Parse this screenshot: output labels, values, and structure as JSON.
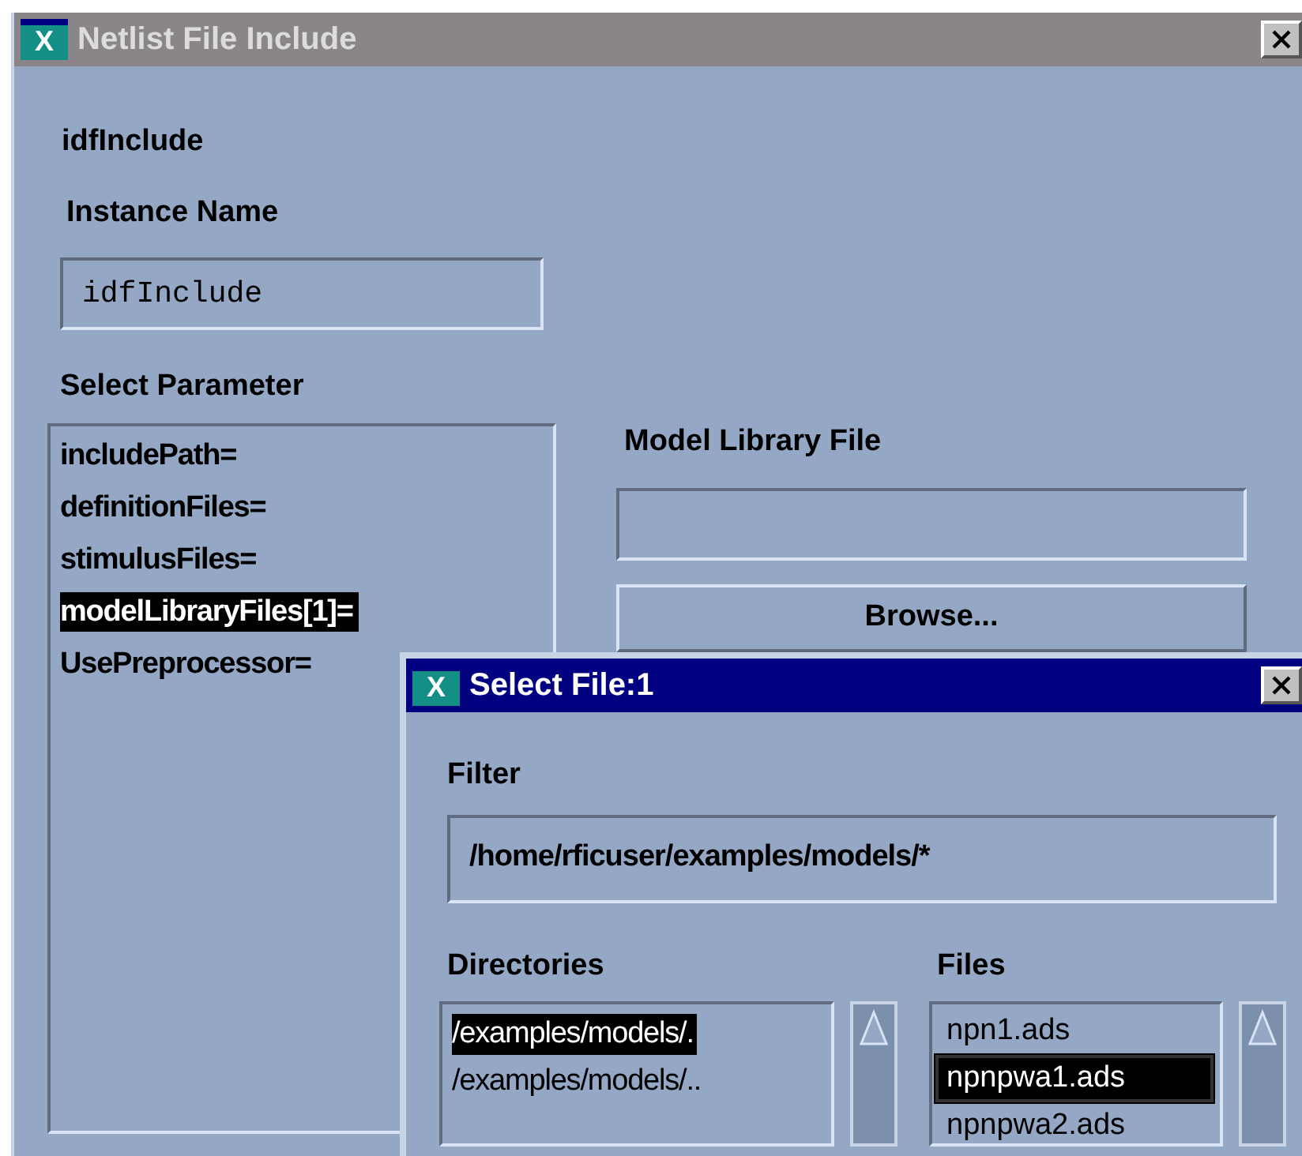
{
  "window": {
    "logo": "X",
    "title": "Netlist File Include"
  },
  "component": "idfInclude",
  "instance_name": {
    "label": "Instance Name",
    "value": "idfInclude"
  },
  "select_parameter": {
    "label": "Select Parameter",
    "items": [
      {
        "label": "includePath=",
        "selected": false
      },
      {
        "label": "definitionFiles=",
        "selected": false
      },
      {
        "label": "stimulusFiles=",
        "selected": false
      },
      {
        "label": "modelLibraryFiles[1]=",
        "selected": true
      },
      {
        "label": "UsePreprocessor=",
        "selected": false
      }
    ]
  },
  "model_library_file": {
    "label": "Model Library File"
  },
  "browse_button": "Browse...",
  "dialog": {
    "logo": "X",
    "title": "Select File:1",
    "filter": {
      "label": "Filter",
      "value": "/home/rficuser/examples/models/*"
    },
    "directories": {
      "label": "Directories",
      "items": [
        {
          "label": "/examples/models/.",
          "selected": true
        },
        {
          "label": "/examples/models/..",
          "selected": false
        }
      ]
    },
    "files": {
      "label": "Files",
      "items": [
        {
          "label": "npn1.ads",
          "selected": false
        },
        {
          "label": "npnpwa1.ads",
          "selected": true
        },
        {
          "label": "npnpwa2.ads",
          "selected": false
        }
      ]
    }
  }
}
